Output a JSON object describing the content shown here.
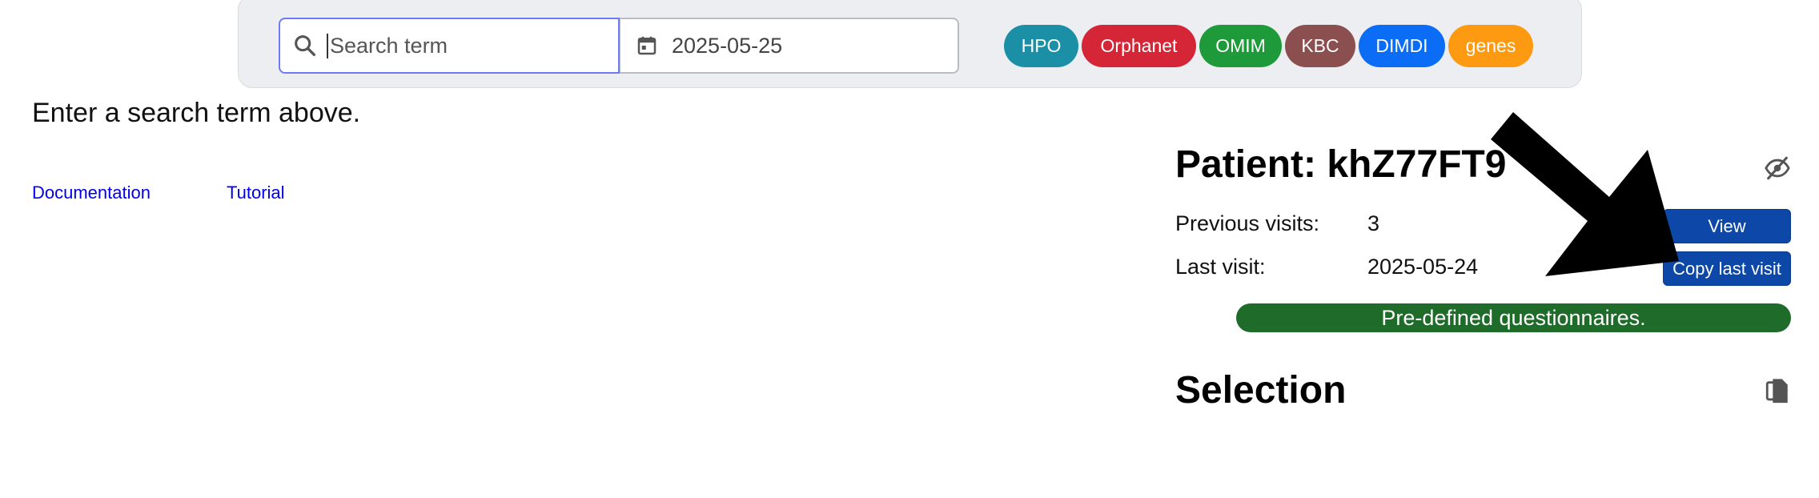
{
  "search": {
    "placeholder": "Search term",
    "date_value": "2025-05-25",
    "search_icon": "magnifier-icon",
    "date_icon": "calendar-icon"
  },
  "tags": [
    {
      "label": "HPO",
      "color": "#1a8fa6"
    },
    {
      "label": "Orphanet",
      "color": "#d42637"
    },
    {
      "label": "OMIM",
      "color": "#1f9a3a"
    },
    {
      "label": "KBC",
      "color": "#8c4f4f"
    },
    {
      "label": "DIMDI",
      "color": "#0b6cf6"
    },
    {
      "label": "genes",
      "color": "#fd9a12"
    }
  ],
  "main": {
    "prompt": "Enter a search term above.",
    "links": {
      "documentation": "Documentation",
      "tutorial": "Tutorial"
    }
  },
  "patient": {
    "title": "Patient: khZ77FT9",
    "hide_icon": "eye-slash-icon",
    "previous_visits_label": "Previous visits:",
    "previous_visits_value": "3",
    "last_visit_label": "Last visit:",
    "last_visit_value": "2025-05-24",
    "view_button": "View",
    "copy_button": "Copy last visit",
    "questionnaires": "Pre-defined questionnaires.",
    "questionnaires_color": "#1e6b2a",
    "button_color": "#0d47a8"
  },
  "selection": {
    "title": "Selection",
    "copy_icon": "copy-icon"
  },
  "annotation": {
    "arrow_icon": "black-pointer-arrow"
  }
}
